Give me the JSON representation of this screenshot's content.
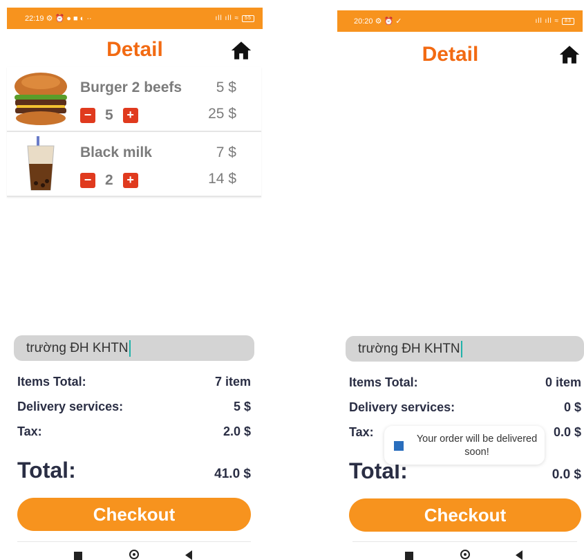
{
  "screens": [
    {
      "status_time": "22:19",
      "status_icons": "⚙ ⏰ ● ■ ◐ ··",
      "signal": "ıll ıll ≈",
      "battery": "55",
      "title": "Detail",
      "items": [
        {
          "name": "Burger 2 beefs",
          "unit_price": "5 $",
          "qty": "5",
          "line_total": "25 $",
          "image": "burger-image"
        },
        {
          "name": "Black milk",
          "unit_price": "7 $",
          "qty": "2",
          "line_total": "14 $",
          "image": "milk-tea-image"
        }
      ],
      "address": "trường ĐH KHTN",
      "summary": {
        "items_total_label": "Items Total:",
        "items_total_value": "7 item",
        "delivery_label": "Delivery services:",
        "delivery_value": "5 $",
        "tax_label": "Tax:",
        "tax_value": "2.0 $",
        "total_label": "Total:",
        "total_value": "41.0 $"
      },
      "checkout_label": "Checkout"
    },
    {
      "status_time": "20:20",
      "status_icons": "⚙ ⏰ ✓",
      "signal": "ıll ıll ≈",
      "battery": "83",
      "title": "Detail",
      "items": [],
      "address": "trường ĐH KHTN",
      "summary": {
        "items_total_label": "Items Total:",
        "items_total_value": "0 item",
        "delivery_label": "Delivery services:",
        "delivery_value": "0 $",
        "tax_label": "Tax:",
        "tax_value": "0.0 $",
        "total_label": "Total:",
        "total_value": "0.0 $"
      },
      "checkout_label": "Checkout",
      "toast": "Your order will be delivered soon!"
    }
  ],
  "colors": {
    "accent": "#f7931e",
    "title": "#f26a12",
    "qty_button": "#e03a1e",
    "text_dark": "#2a2e44"
  },
  "icons": [
    "home-icon",
    "minus-icon",
    "plus-icon",
    "nav-recents-icon",
    "nav-home-icon",
    "nav-back-icon",
    "app-icon"
  ]
}
